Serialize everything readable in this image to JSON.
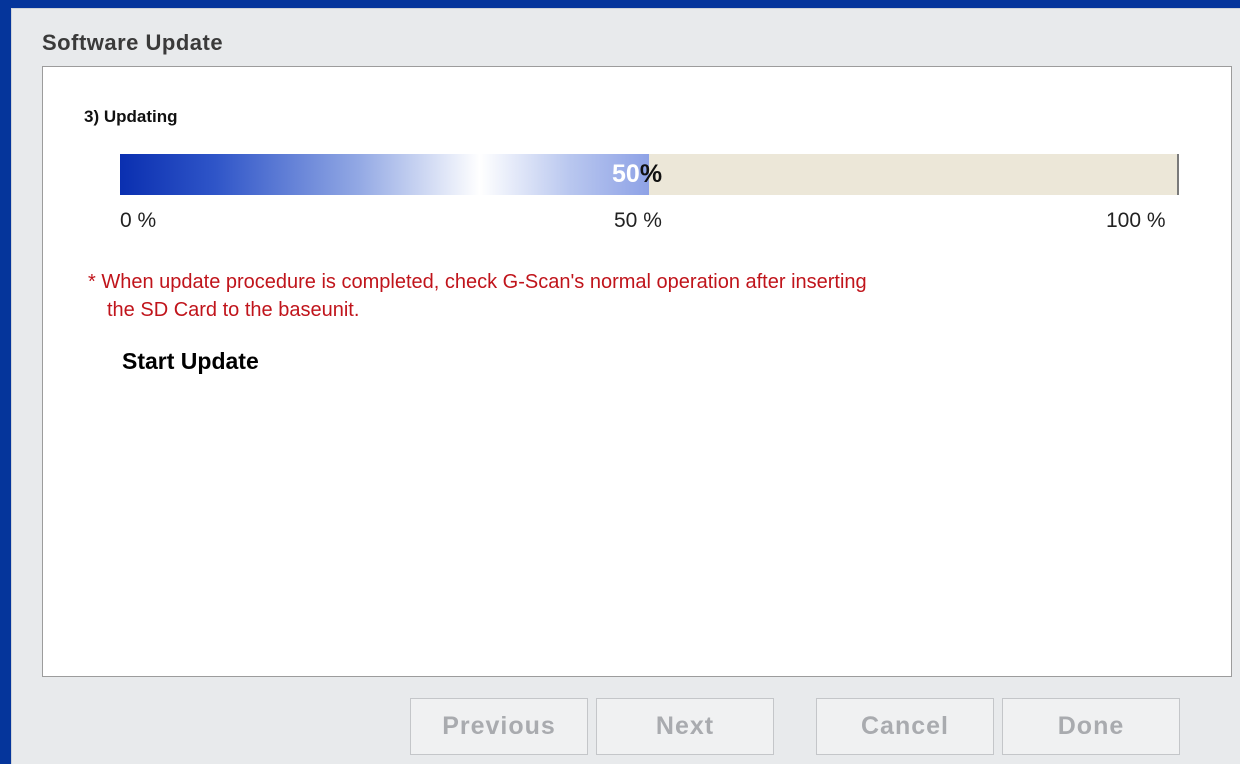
{
  "window": {
    "title": "Software Update"
  },
  "step": {
    "label": "3) Updating"
  },
  "progress": {
    "value_percent": 50,
    "label_number": "50",
    "label_suffix": "%",
    "ticks": [
      "0 %",
      "50 %",
      "100 %"
    ]
  },
  "note": {
    "line1": "* When update procedure is completed, check G-Scan's normal operation after inserting",
    "line2": "the SD Card to the baseunit."
  },
  "actions": {
    "start_update": "Start Update"
  },
  "buttons": {
    "previous": "Previous",
    "next": "Next",
    "cancel": "Cancel",
    "done": "Done"
  },
  "colors": {
    "desktop_background": "#05359b",
    "note_text": "#c0141b",
    "progress_fill_start": "#0a2fb0",
    "progress_track": "#ece7d8"
  }
}
